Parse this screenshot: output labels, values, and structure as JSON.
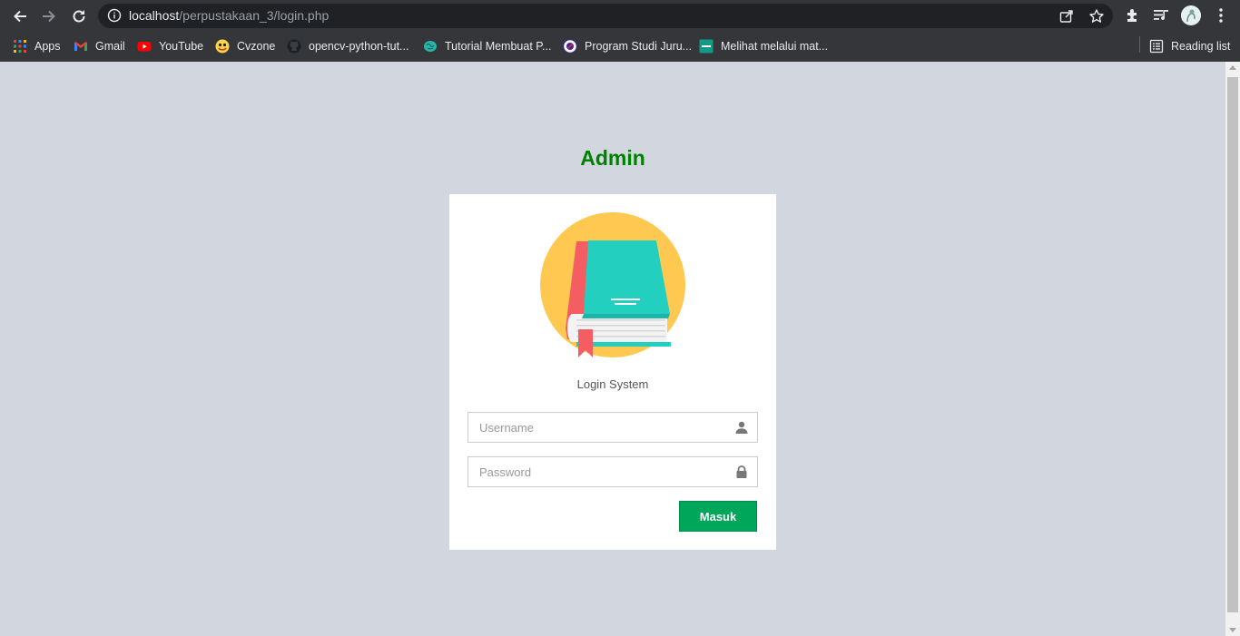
{
  "browser": {
    "url_host": "localhost",
    "url_path": "/perpustakaan_3/login.php",
    "reading_list_label": "Reading list"
  },
  "bookmarks": [
    {
      "label": "Apps",
      "icon": "apps-grid-icon"
    },
    {
      "label": "Gmail",
      "icon": "gmail-icon"
    },
    {
      "label": "YouTube",
      "icon": "youtube-icon"
    },
    {
      "label": "Cvzone",
      "icon": "cvzone-icon"
    },
    {
      "label": "opencv-python-tut...",
      "icon": "github-icon"
    },
    {
      "label": "Tutorial Membuat P...",
      "icon": "brain-icon"
    },
    {
      "label": "Program Studi Juru...",
      "icon": "university-icon"
    },
    {
      "label": "Melihat melalui mat...",
      "icon": "bookmark-page-icon"
    }
  ],
  "login": {
    "title": "Admin",
    "message": "Login System",
    "username_placeholder": "Username",
    "password_placeholder": "Password",
    "submit_label": "Masuk"
  },
  "colors": {
    "page_bg": "#d2d6de",
    "title": "#008000",
    "button": "#00a65a",
    "logo_circle": "#ffc850",
    "book_cover": "#23d0c0",
    "book_spine": "#f45d62"
  }
}
